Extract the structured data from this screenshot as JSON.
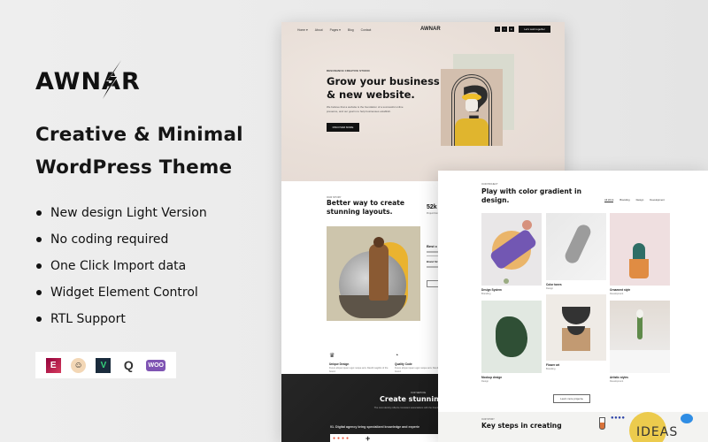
{
  "brand": {
    "logo_text": "AWNAR",
    "headline_line1": "Creative & Minimal",
    "headline_line2": "WordPress Theme"
  },
  "features": [
    "New design Light Version",
    "No coding required",
    "One Click Import data",
    "Widget Element Control",
    "RTL Support"
  ],
  "plugins": [
    {
      "name": "elementor",
      "glyph": "E"
    },
    {
      "name": "mailchimp",
      "glyph": "☺"
    },
    {
      "name": "envato",
      "glyph": "V"
    },
    {
      "name": "revolution-slider",
      "glyph": "Q"
    },
    {
      "name": "woocommerce",
      "glyph": "WOO"
    }
  ],
  "mockup_home": {
    "nav": {
      "items": [
        "Home ▾",
        "About",
        "Pages ▾",
        "Blog",
        "Contact"
      ],
      "logo": "AWNAR",
      "socials": [
        "f",
        "t",
        "in"
      ],
      "cta": "Let's work together"
    },
    "hero": {
      "eyebrow": "RESONANCE CREATIVE STUDIO",
      "title_line1": "Grow your business",
      "title_line2": "& new website.",
      "description": "We believe that a website is the foundation of a successful online presence, and our goal is to help businesses establish.",
      "button": "DISCOVER MORE"
    },
    "story": {
      "eyebrow": "OUR STORY",
      "title_line1": "Better way to create",
      "title_line2": "stunning layouts.",
      "stat_value": "52k",
      "stat_label": "Project Done",
      "side_heading": "Best c",
      "side_subheading": "Brand Str",
      "features": [
        {
          "icon": "♛",
          "title": "Unique Design",
          "desc": "Fusce aliquet quam eget neque arcu blandit sagittis of the brand."
        },
        {
          "icon": "◔",
          "title": "Quality Code",
          "desc": "Fusce aliquet quam eget neque arcu blandit sagittis of the brand."
        }
      ]
    },
    "services": {
      "eyebrow": "OUR SERVICE",
      "title": "Create stunning",
      "description": "The core identity reflects consistent associations with the brand. It explores the intricate details of",
      "subheading": "01. Digital agency bring specialized knowledge and experie"
    }
  },
  "mockup_projects": {
    "eyebrow": "OUR PROJECT",
    "title_line1": "Play with color gradient in",
    "title_line2": "design.",
    "filters": [
      "All Work",
      "Branding",
      "Design",
      "Development"
    ],
    "active_filter": "All Work",
    "cards": [
      {
        "title": "Design System",
        "category": "Branding"
      },
      {
        "title": "Color tones",
        "category": "Design"
      },
      {
        "title": "Ornament style",
        "category": "Development"
      },
      {
        "title": "Mockup design",
        "category": "Design"
      },
      {
        "title": "Flower art",
        "category": "Branding"
      },
      {
        "title": "Artistic styles",
        "category": "Development"
      }
    ],
    "more_button": "Learn more project ▸",
    "story": {
      "eyebrow": "OUR STORY",
      "title": "Key steps in creating",
      "ideas_text": "IDEAS"
    }
  }
}
